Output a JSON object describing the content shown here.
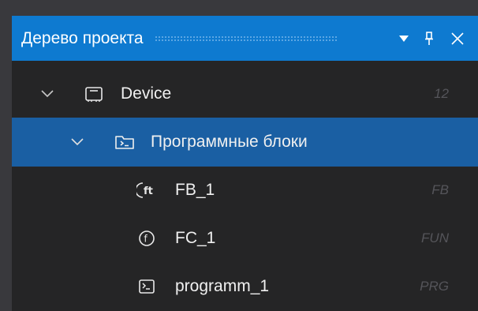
{
  "panel": {
    "title": "Дерево проекта",
    "accent_color": "#0e7ad0",
    "selected_color": "#1a5fa3",
    "buttons": [
      {
        "name": "dropdown",
        "icon": "triangle-down-icon"
      },
      {
        "name": "pin",
        "icon": "pin-icon"
      },
      {
        "name": "close",
        "icon": "close-icon"
      }
    ]
  },
  "tree": {
    "nodes": [
      {
        "label": "Device",
        "kind": "12",
        "icon": "device-icon",
        "expanded": true,
        "selected": false,
        "level": 0
      },
      {
        "label": "Программные блоки",
        "kind": "",
        "icon": "folder-terminal-icon",
        "expanded": true,
        "selected": true,
        "level": 1
      },
      {
        "label": "FB_1",
        "kind": "FB",
        "icon": "function-block-icon",
        "selected": false,
        "level": 2
      },
      {
        "label": "FC_1",
        "kind": "FUN",
        "icon": "function-icon",
        "selected": false,
        "level": 2
      },
      {
        "label": "programm_1",
        "kind": "PRG",
        "icon": "program-icon",
        "selected": false,
        "level": 2
      }
    ]
  }
}
